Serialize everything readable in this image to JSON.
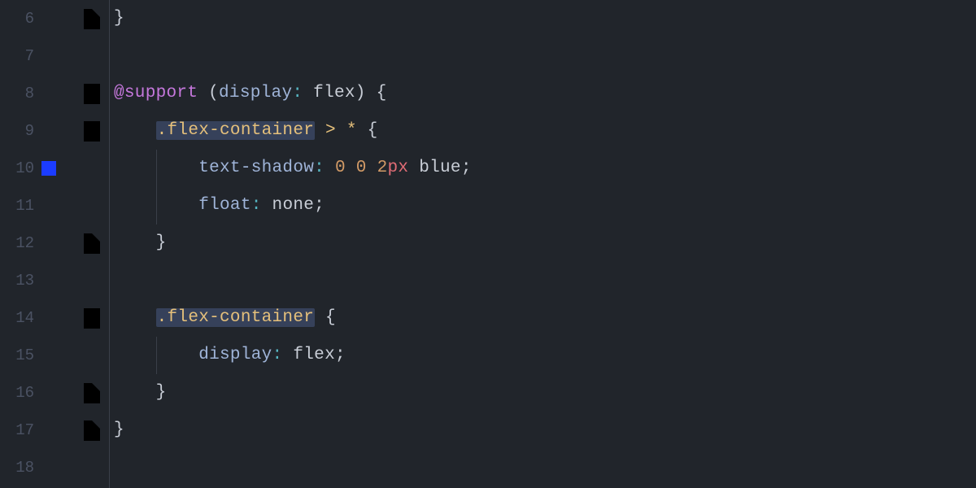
{
  "lines": {
    "6": {
      "num": "6"
    },
    "7": {
      "num": "7"
    },
    "8": {
      "num": "8",
      "kw": "@support",
      "paren_open": "(",
      "prop": "display",
      "colon": ":",
      "val": "flex",
      "paren_close": ")",
      "brace": "{"
    },
    "9": {
      "num": "9",
      "sel": ".flex-container",
      "gt": ">",
      "star": "*",
      "brace": "{"
    },
    "10": {
      "num": "10",
      "prop": "text-shadow",
      "colon": ":",
      "v1": "0",
      "v2": "0",
      "v3_num": "2",
      "v3_unit": "px",
      "v4": "blue",
      "semi": ";"
    },
    "11": {
      "num": "11",
      "prop": "float",
      "colon": ":",
      "val": "none",
      "semi": ";"
    },
    "12": {
      "num": "12",
      "brace": "}"
    },
    "13": {
      "num": "13"
    },
    "14": {
      "num": "14",
      "sel": ".flex-container",
      "brace": "{"
    },
    "15": {
      "num": "15",
      "prop": "display",
      "colon": ":",
      "val": "flex",
      "semi": ";"
    },
    "16": {
      "num": "16",
      "brace": "}"
    },
    "17": {
      "num": "17",
      "brace": "}"
    },
    "18": {
      "num": "18"
    }
  },
  "colors": {
    "gutter_marker": "#1b3cff"
  }
}
